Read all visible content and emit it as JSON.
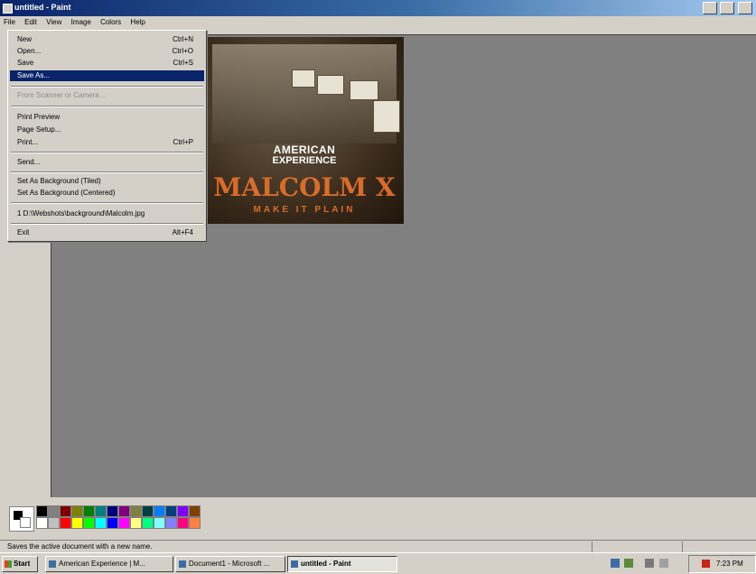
{
  "window": {
    "title": "untitled - Paint"
  },
  "menubar": {
    "items": [
      "File",
      "Edit",
      "View",
      "Image",
      "Colors",
      "Help"
    ]
  },
  "file_menu": {
    "items": [
      {
        "label": "New",
        "shortcut": "Ctrl+N"
      },
      {
        "label": "Open...",
        "shortcut": "Ctrl+O"
      },
      {
        "label": "Save",
        "shortcut": "Ctrl+S"
      },
      {
        "label": "Save As...",
        "shortcut": ""
      },
      {
        "label": "From Scanner or Camera...",
        "shortcut": ""
      },
      {
        "label": "Print Preview",
        "shortcut": ""
      },
      {
        "label": "Page Setup...",
        "shortcut": ""
      },
      {
        "label": "Print...",
        "shortcut": "Ctrl+P"
      },
      {
        "label": "Send...",
        "shortcut": ""
      },
      {
        "label": "Set As Background (Tiled)",
        "shortcut": ""
      },
      {
        "label": "Set As Background (Centered)",
        "shortcut": ""
      },
      {
        "label": "1 D:\\Webshots\\background\\Malcolm.jpg",
        "shortcut": ""
      },
      {
        "label": "Exit",
        "shortcut": "Alt+F4"
      }
    ],
    "highlighted": "Save As..."
  },
  "canvas": {
    "brand_line1": "AMERICAN",
    "brand_line2": "EXPERIENCE",
    "headline": "MALCOLM X",
    "tagline": "MAKE IT PLAIN"
  },
  "palette": {
    "foreground": "#000000",
    "background": "#ffffff",
    "row1": [
      "#000000",
      "#808080",
      "#800000",
      "#808000",
      "#008000",
      "#008080",
      "#000080",
      "#800080",
      "#808040",
      "#004040",
      "#0080ff",
      "#004080",
      "#8000ff",
      "#804000"
    ],
    "row2": [
      "#ffffff",
      "#c0c0c0",
      "#ff0000",
      "#ffff00",
      "#00ff00",
      "#00ffff",
      "#0000ff",
      "#ff00ff",
      "#ffff80",
      "#00ff80",
      "#80ffff",
      "#8080ff",
      "#ff0080",
      "#ff8040"
    ]
  },
  "statusbar": {
    "text": "Saves the active document with a new name."
  },
  "taskbar": {
    "start_label": "Start",
    "tasks": [
      {
        "label": "American Experience | M...",
        "active": false
      },
      {
        "label": "Document1 - Microsoft ...",
        "active": false
      },
      {
        "label": "untitled - Paint",
        "active": true
      }
    ],
    "clock": "7:23 PM"
  }
}
